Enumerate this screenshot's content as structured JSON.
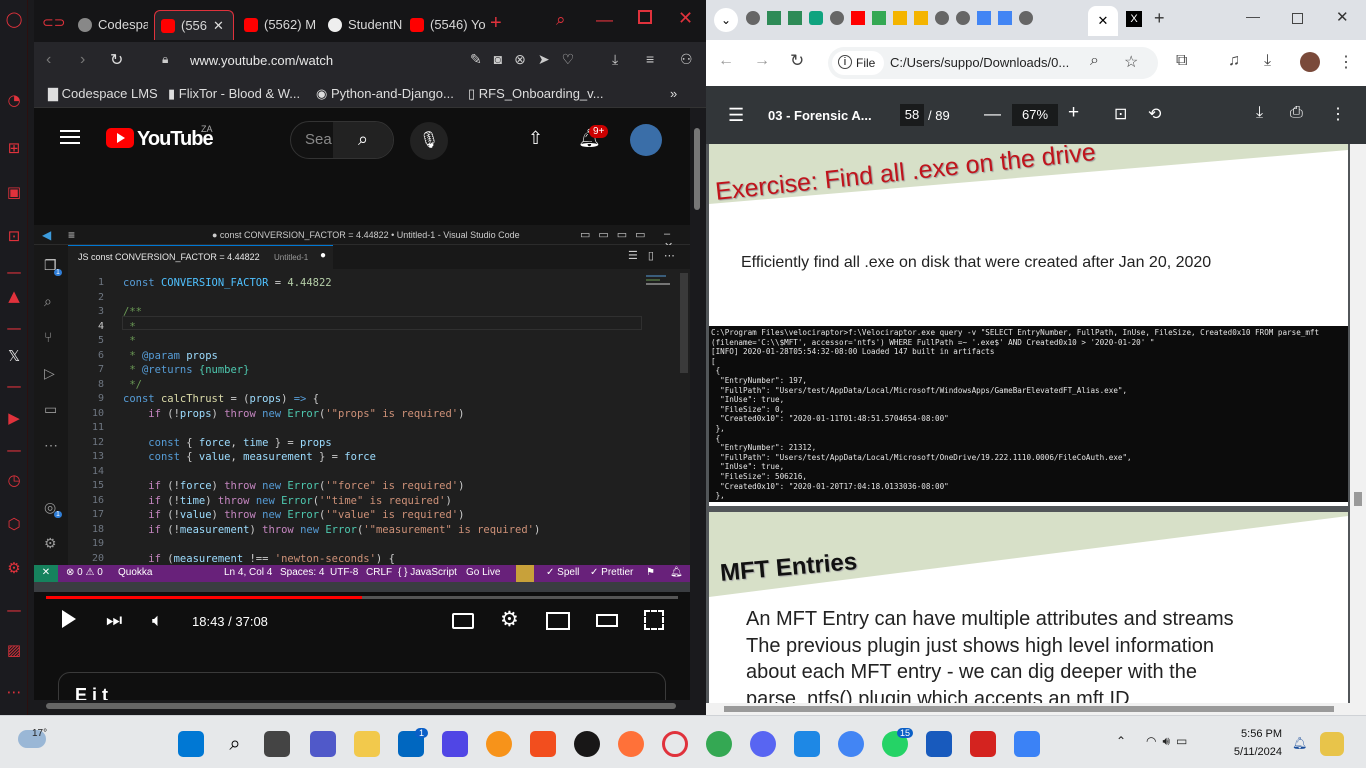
{
  "opera": {
    "tabs": [
      {
        "label": "Codespa",
        "color": "#555"
      },
      {
        "label": "(556",
        "color": "#ff0000"
      },
      {
        "label": "(5562) M",
        "color": "#ff0000"
      },
      {
        "label": "StudentN",
        "color": "#222"
      },
      {
        "label": "(5546) Yo",
        "color": "#ff0000"
      }
    ],
    "new_tab": "+",
    "url": "www.youtube.com/watch",
    "bookmarks": [
      "Codespace LMS",
      "FlixTor - Blood & W...",
      "Python-and-Django...",
      "RFS_Onboarding_v..."
    ],
    "bookmarks_more": "»"
  },
  "youtube": {
    "logo_text": "YouTube",
    "region": "ZA",
    "search_placeholder": "Sea",
    "notif_count": "9+",
    "time": "18:43 / 37:08",
    "progress": 0.5,
    "below_title": "E     i  t"
  },
  "vscode": {
    "title": "● const CONVERSION_FACTOR = 4.44822 • Untitled-1 - Visual Studio Code",
    "tab_label": "JS  const CONVERSION_FACTOR = 4.44822",
    "tab_file": "Untitled-1",
    "explorer_badge": "1",
    "account_badge": "1",
    "line_numbers": [
      "1",
      "2",
      "3",
      "4",
      "5",
      "6",
      "7",
      "8",
      "9",
      "10",
      "11",
      "12",
      "13",
      "14",
      "15",
      "16",
      "17",
      "18",
      "19",
      "20"
    ],
    "status": {
      "problems": "⊗ 0 ⚠ 0",
      "quokka": "Quokka",
      "position": "Ln 4, Col 4",
      "spaces": "Spaces: 4",
      "encoding": "UTF-8",
      "eol": "CRLF",
      "language": "{ } JavaScript",
      "golive": "Go Live",
      "spell": "✓ Spell",
      "prettier": "✓ Prettier"
    }
  },
  "chrome": {
    "url": "C:/Users/suppo/Downloads/0...",
    "file_chip": "File",
    "pdf_title": "03 - Forensic A...",
    "page_current": "58",
    "page_total": "/ 89",
    "zoom": "67%",
    "slide1": {
      "heading": "Exercise: Find all .exe on the drive",
      "body": "Efficiently find all .exe on disk that were created after Jan 20, 2020",
      "terminal": [
        "C:\\Program Files\\velociraptor>f:\\Velociraptor.exe query -v \"SELECT EntryNumber, FullPath, InUse, FileSize, Created0x10 FROM parse_mft",
        "(filename='C:\\\\$MFT', accessor='ntfs') WHERE FullPath =~ '.exe$' AND Created0x10 > '2020-01-20' \"",
        "[INFO] 2020-01-28T05:54:32-08:00 Loaded 147 built in artifacts",
        "[",
        " {",
        "  \"EntryNumber\": 197,",
        "  \"FullPath\": \"Users/test/AppData/Local/Microsoft/WindowsApps/GameBarElevatedFT_Alias.exe\",",
        "  \"InUse\": true,",
        "  \"FileSize\": 0,",
        "  \"Created0x10\": \"2020-01-11T01:48:51.5704654-08:00\"",
        " },",
        " {",
        "  \"EntryNumber\": 21312,",
        "  \"FullPath\": \"Users/test/AppData/Local/Microsoft/OneDrive/19.222.1110.0006/FileCoAuth.exe\",",
        "  \"InUse\": true,",
        "  \"FileSize\": 506216,",
        "  \"Created0x10\": \"2020-01-20T17:04:18.0133036-08:00\"",
        " },"
      ]
    },
    "slide2": {
      "heading": "MFT Entries",
      "lines": [
        "An MFT Entry can have multiple attributes and streams",
        "The previous plugin just shows high level information",
        "about each MFT entry - we can dig deeper with the",
        "parse_ntfs() plugin which accepts an mft ID"
      ]
    }
  },
  "taskbar": {
    "weather": "17°",
    "time": "5:56 PM",
    "date": "5/11/2024",
    "badge_store": "1",
    "badge_whatsapp": "15"
  }
}
